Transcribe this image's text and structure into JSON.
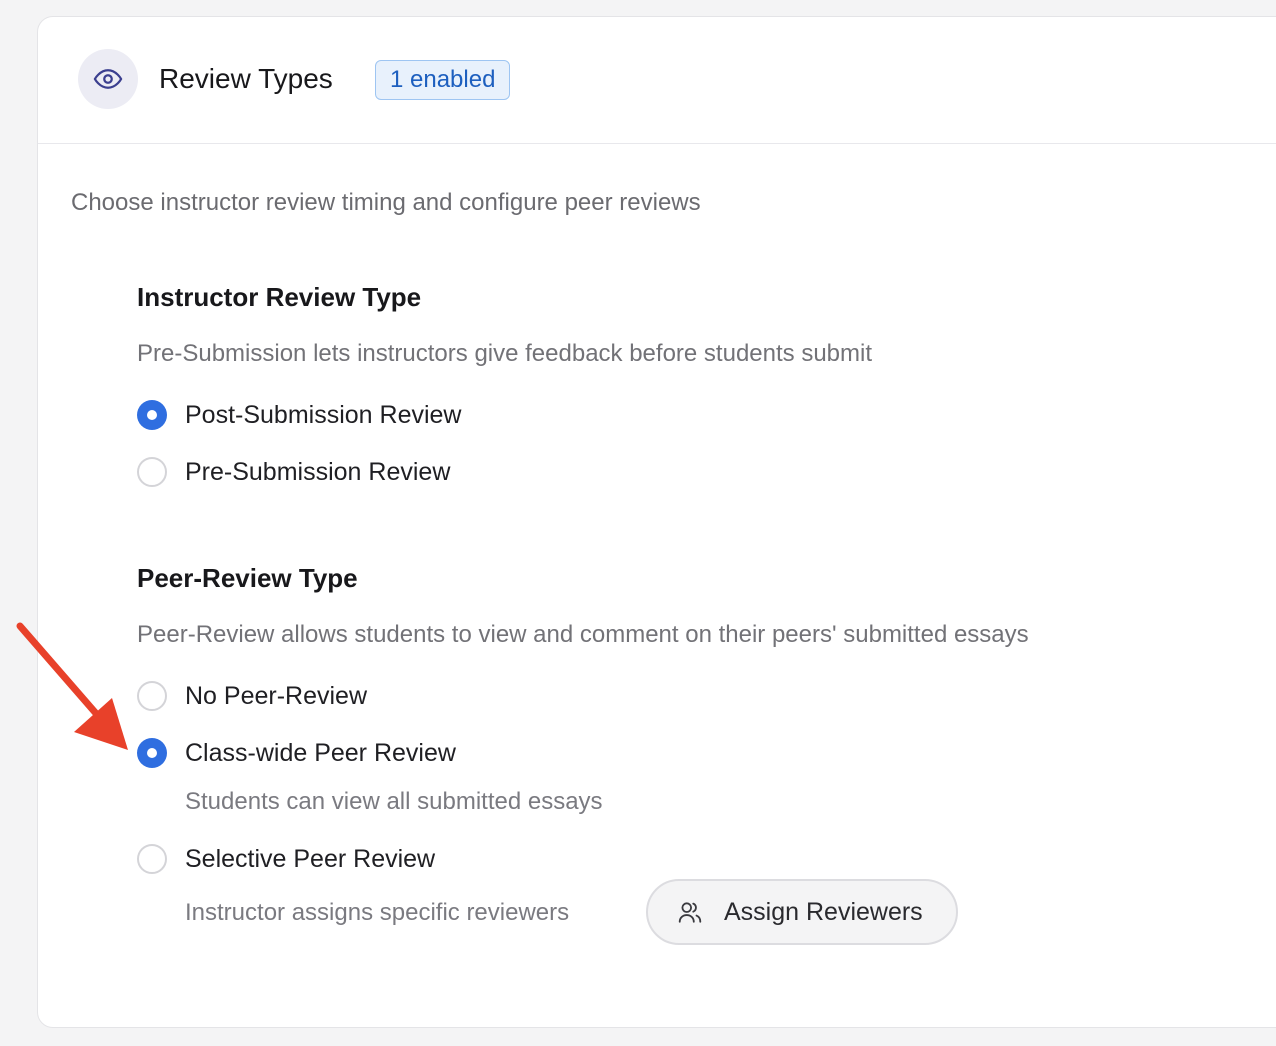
{
  "card": {
    "icon": "eye-icon",
    "title": "Review Types",
    "badge": "1 enabled",
    "description": "Choose instructor review timing and configure peer reviews"
  },
  "instructor_review": {
    "title": "Instructor Review Type",
    "description": "Pre-Submission lets instructors give feedback before students submit",
    "options": [
      {
        "label": "Post-Submission Review",
        "selected": true
      },
      {
        "label": "Pre-Submission Review",
        "selected": false
      }
    ]
  },
  "peer_review": {
    "title": "Peer-Review Type",
    "description": "Peer-Review allows students to view and comment on their peers' submitted essays",
    "options": [
      {
        "label": "No Peer-Review",
        "selected": false,
        "hint": ""
      },
      {
        "label": "Class-wide Peer Review",
        "selected": true,
        "hint": "Students can view all submitted essays"
      },
      {
        "label": "Selective Peer Review",
        "selected": false,
        "hint": "Instructor assigns specific reviewers"
      }
    ],
    "assign_button": {
      "icon": "users-icon",
      "label": "Assign Reviewers"
    }
  },
  "annotation": {
    "icon": "red-arrow-icon",
    "color": "#e8412a"
  },
  "colors": {
    "accent": "#2f6ee0",
    "badge_text": "#1d5fbf",
    "badge_bg": "#e8f1fc"
  }
}
